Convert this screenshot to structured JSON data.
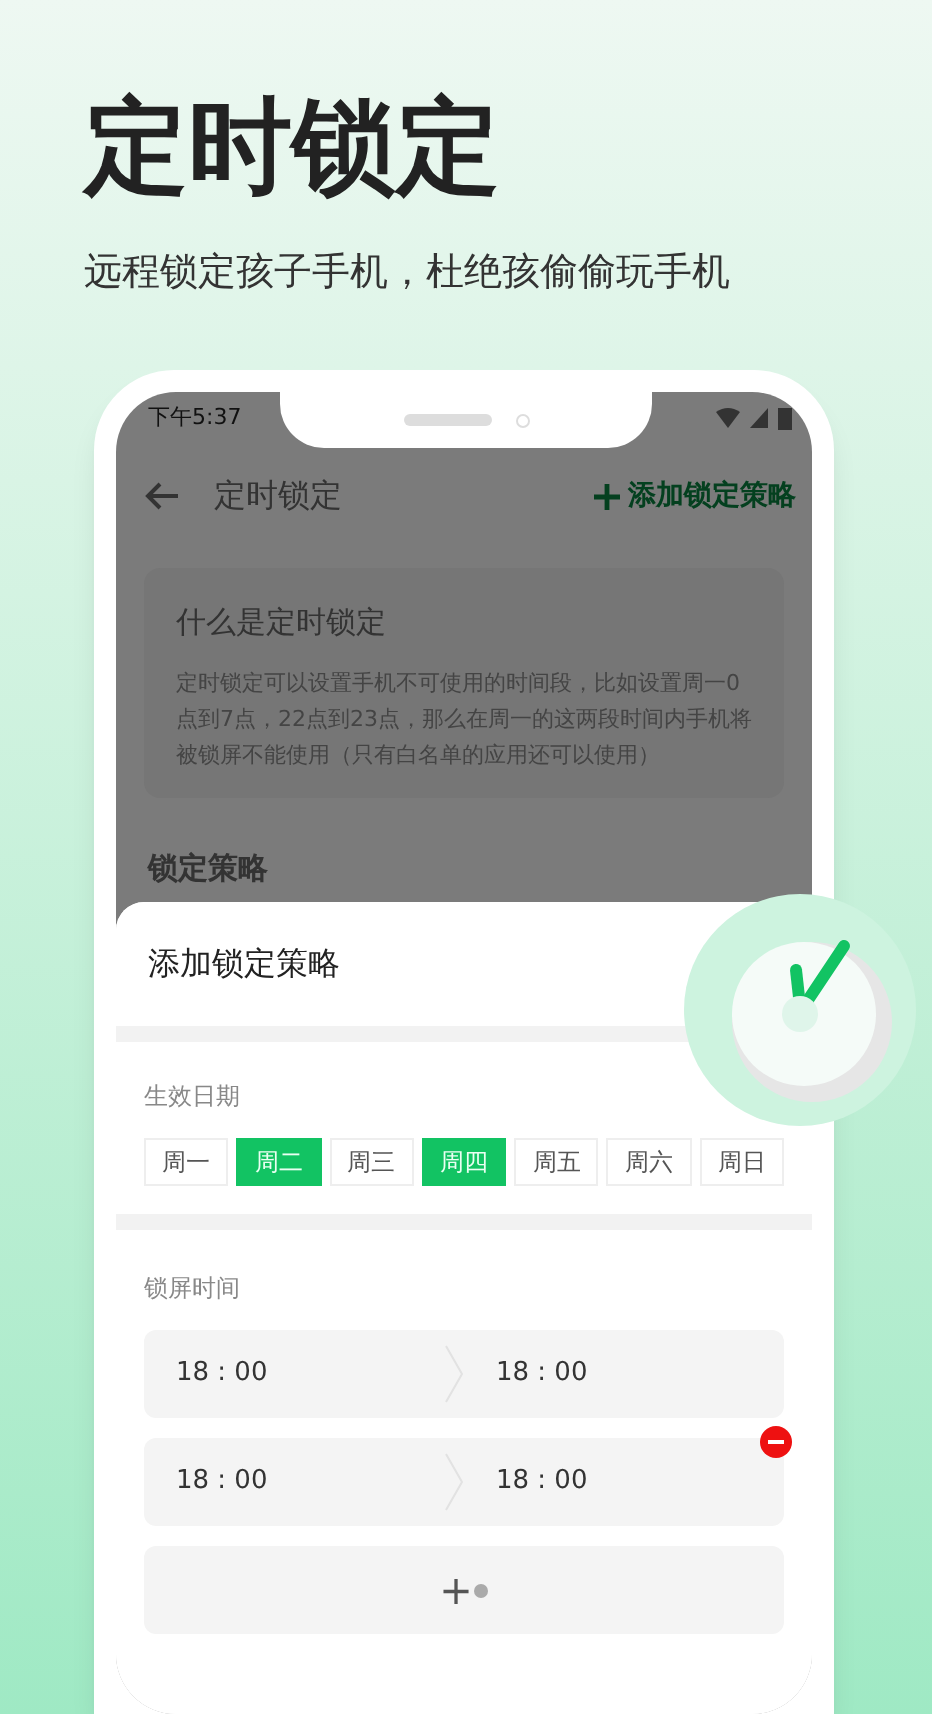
{
  "headline": "定时锁定",
  "subtitle": "远程锁定孩子手机，杜绝孩偷偷玩手机",
  "status_bar": {
    "time": "下午5:37"
  },
  "nav": {
    "title": "定时锁定",
    "action": "添加锁定策略"
  },
  "info_card": {
    "title": "什么是定时锁定",
    "body": "定时锁定可以设置手机不可使用的时间段，比如设置周一0点到7点，22点到23点，那么在周一的这两段时间内手机将被锁屏不能使用（只有白名单的应用还可以使用）"
  },
  "section_title": "锁定策略",
  "sheet": {
    "title": "添加锁定策略",
    "days_label": "生效日期",
    "days": [
      {
        "label": "周一",
        "selected": false
      },
      {
        "label": "周二",
        "selected": true
      },
      {
        "label": "周三",
        "selected": false
      },
      {
        "label": "周四",
        "selected": true
      },
      {
        "label": "周五",
        "selected": false
      },
      {
        "label": "周六",
        "selected": false
      },
      {
        "label": "周日",
        "selected": false
      }
    ],
    "time_label": "锁屏时间",
    "time_ranges": [
      {
        "start": "18 : 00",
        "end": "18 : 00",
        "removable": false
      },
      {
        "start": "18 : 00",
        "end": "18 : 00",
        "removable": true
      }
    ],
    "add_label": "+"
  }
}
